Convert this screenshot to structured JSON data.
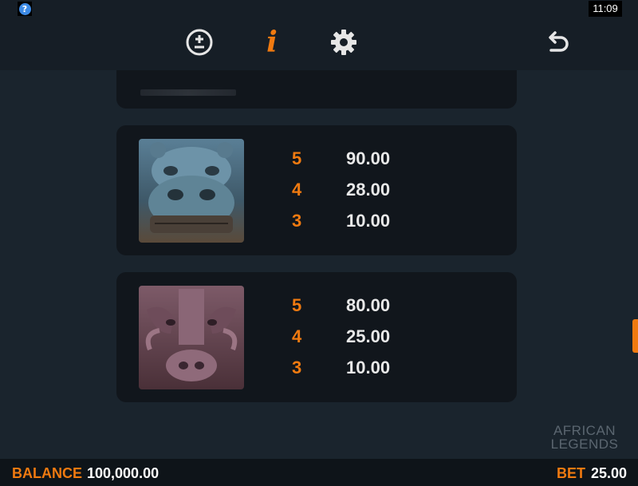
{
  "status": {
    "help_glyph": "?",
    "time": "11:09"
  },
  "toolbar": {
    "icons": [
      "plus-minus-icon",
      "info-icon",
      "gear-icon",
      "back-arrow-icon"
    ],
    "info_glyph": "i"
  },
  "paytable": {
    "cards": [
      {
        "symbol": "hippo-symbol",
        "pays": [
          {
            "count": "5",
            "value": "90.00"
          },
          {
            "count": "4",
            "value": "28.00"
          },
          {
            "count": "3",
            "value": "10.00"
          }
        ]
      },
      {
        "symbol": "warthog-symbol",
        "pays": [
          {
            "count": "5",
            "value": "80.00"
          },
          {
            "count": "4",
            "value": "25.00"
          },
          {
            "count": "3",
            "value": "10.00"
          }
        ]
      }
    ]
  },
  "logo": {
    "line1": "AFRICAN",
    "line2": "LEGENDS"
  },
  "footer": {
    "balance_label": "BALANCE",
    "balance_value": "100,000.00",
    "bet_label": "BET",
    "bet_value": "25.00"
  },
  "colors": {
    "accent": "#f07a10",
    "background": "#1a242d",
    "card": "#11161c"
  }
}
